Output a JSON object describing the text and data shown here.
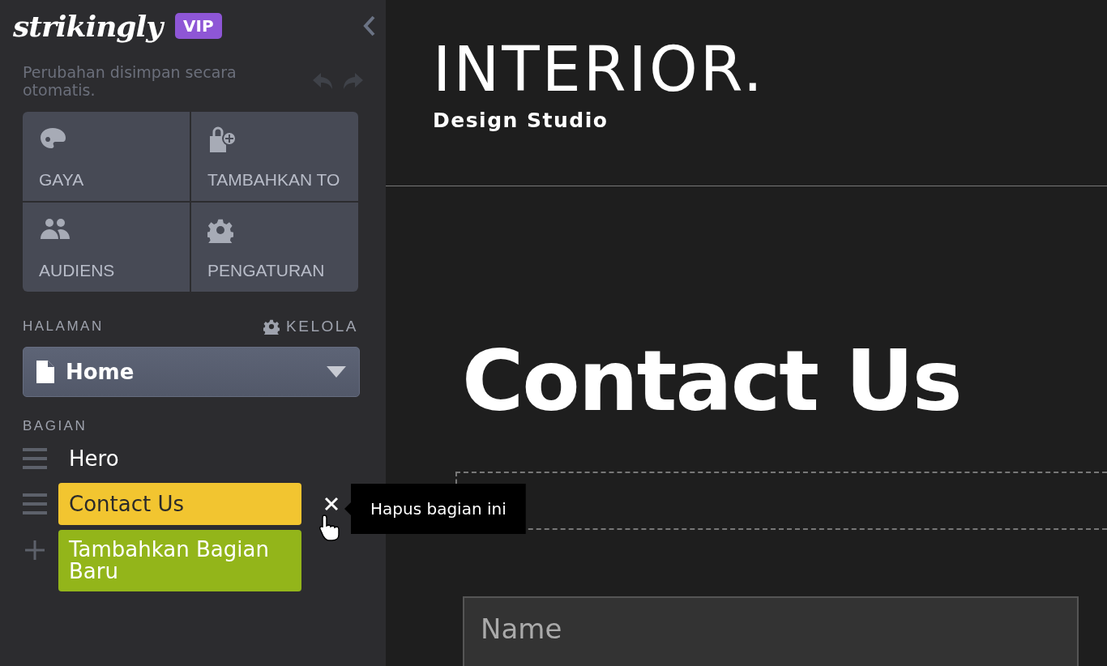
{
  "sidebar": {
    "logo": "strikingly",
    "badge": "VIP",
    "autosave": "Perubahan disimpan secara otomatis.",
    "tiles": [
      {
        "kind": "palette",
        "label": "GAYA"
      },
      {
        "kind": "store",
        "label": "TAMBAHKAN TO"
      },
      {
        "kind": "people",
        "label": "AUDIENS"
      },
      {
        "kind": "gear",
        "label": "PENGATURAN"
      }
    ],
    "pages_heading": "HALAMAN",
    "manage": "KELOLA",
    "page_select": "Home",
    "sections_heading": "BAGIAN",
    "sections": [
      {
        "label": "Hero",
        "selected": false
      },
      {
        "label": "Contact Us",
        "selected": true
      }
    ],
    "add_section": "Tambahkan Bagian Baru",
    "tooltip": "Hapus bagian ini"
  },
  "preview": {
    "brand": "INTERIOR.",
    "tagline": "Design Studio",
    "heading": "Contact Us",
    "name_field": {
      "placeholder": "Name"
    }
  }
}
